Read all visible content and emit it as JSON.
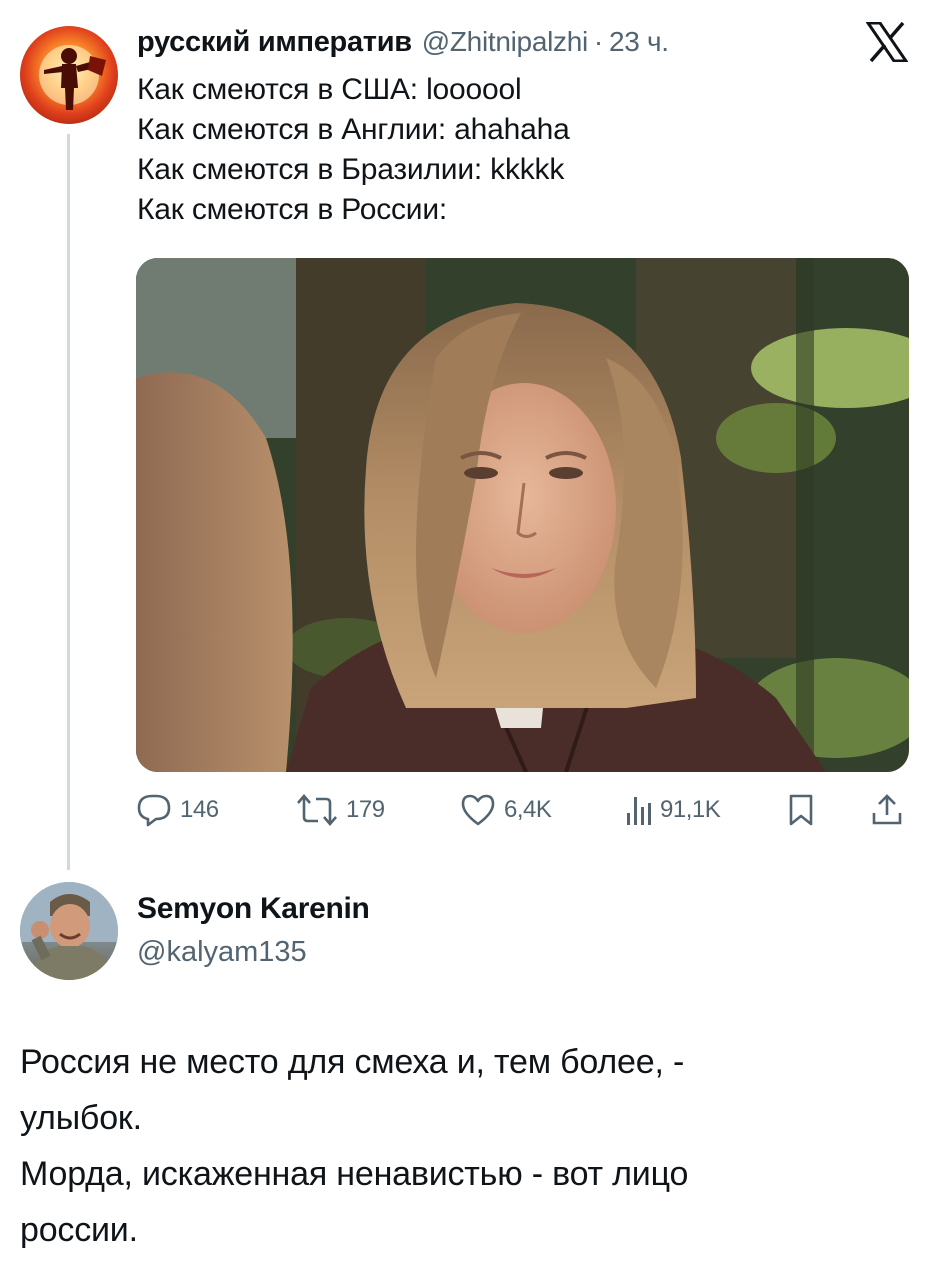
{
  "tweet": {
    "author_name": "русский императив",
    "handle": "@Zhitnipalzhi",
    "separator": "·",
    "time": "23 ч.",
    "lines": [
      "Как смеются в США: loooool",
      "Как смеются в Англии: ahahaha",
      "Как смеются в Бразилии: kkkkk",
      "Как смеются в России:"
    ],
    "media_alt": "photo-woman-long-hair-leather-jacket-jungle-background",
    "stats": {
      "replies": "146",
      "retweets": "179",
      "likes": "6,4K",
      "views": "91,1K"
    }
  },
  "reply": {
    "author_name": "Semyon Karenin",
    "handle": "@kalyam135",
    "lines": [
      "Россия не место для смеха и, тем более, -",
      "улыбок.",
      "Морда, искаженная ненавистью - вот лицо",
      "россии."
    ]
  },
  "icons": {
    "brand": "x-logo-icon",
    "reply": "reply-icon",
    "retweet": "retweet-icon",
    "like": "heart-icon",
    "views": "views-bar-chart-icon",
    "bookmark": "bookmark-icon",
    "share": "share-icon"
  },
  "colors": {
    "text": "#0f1419",
    "secondary": "#536471",
    "thread_line": "#cfd9de",
    "background": "#ffffff"
  }
}
